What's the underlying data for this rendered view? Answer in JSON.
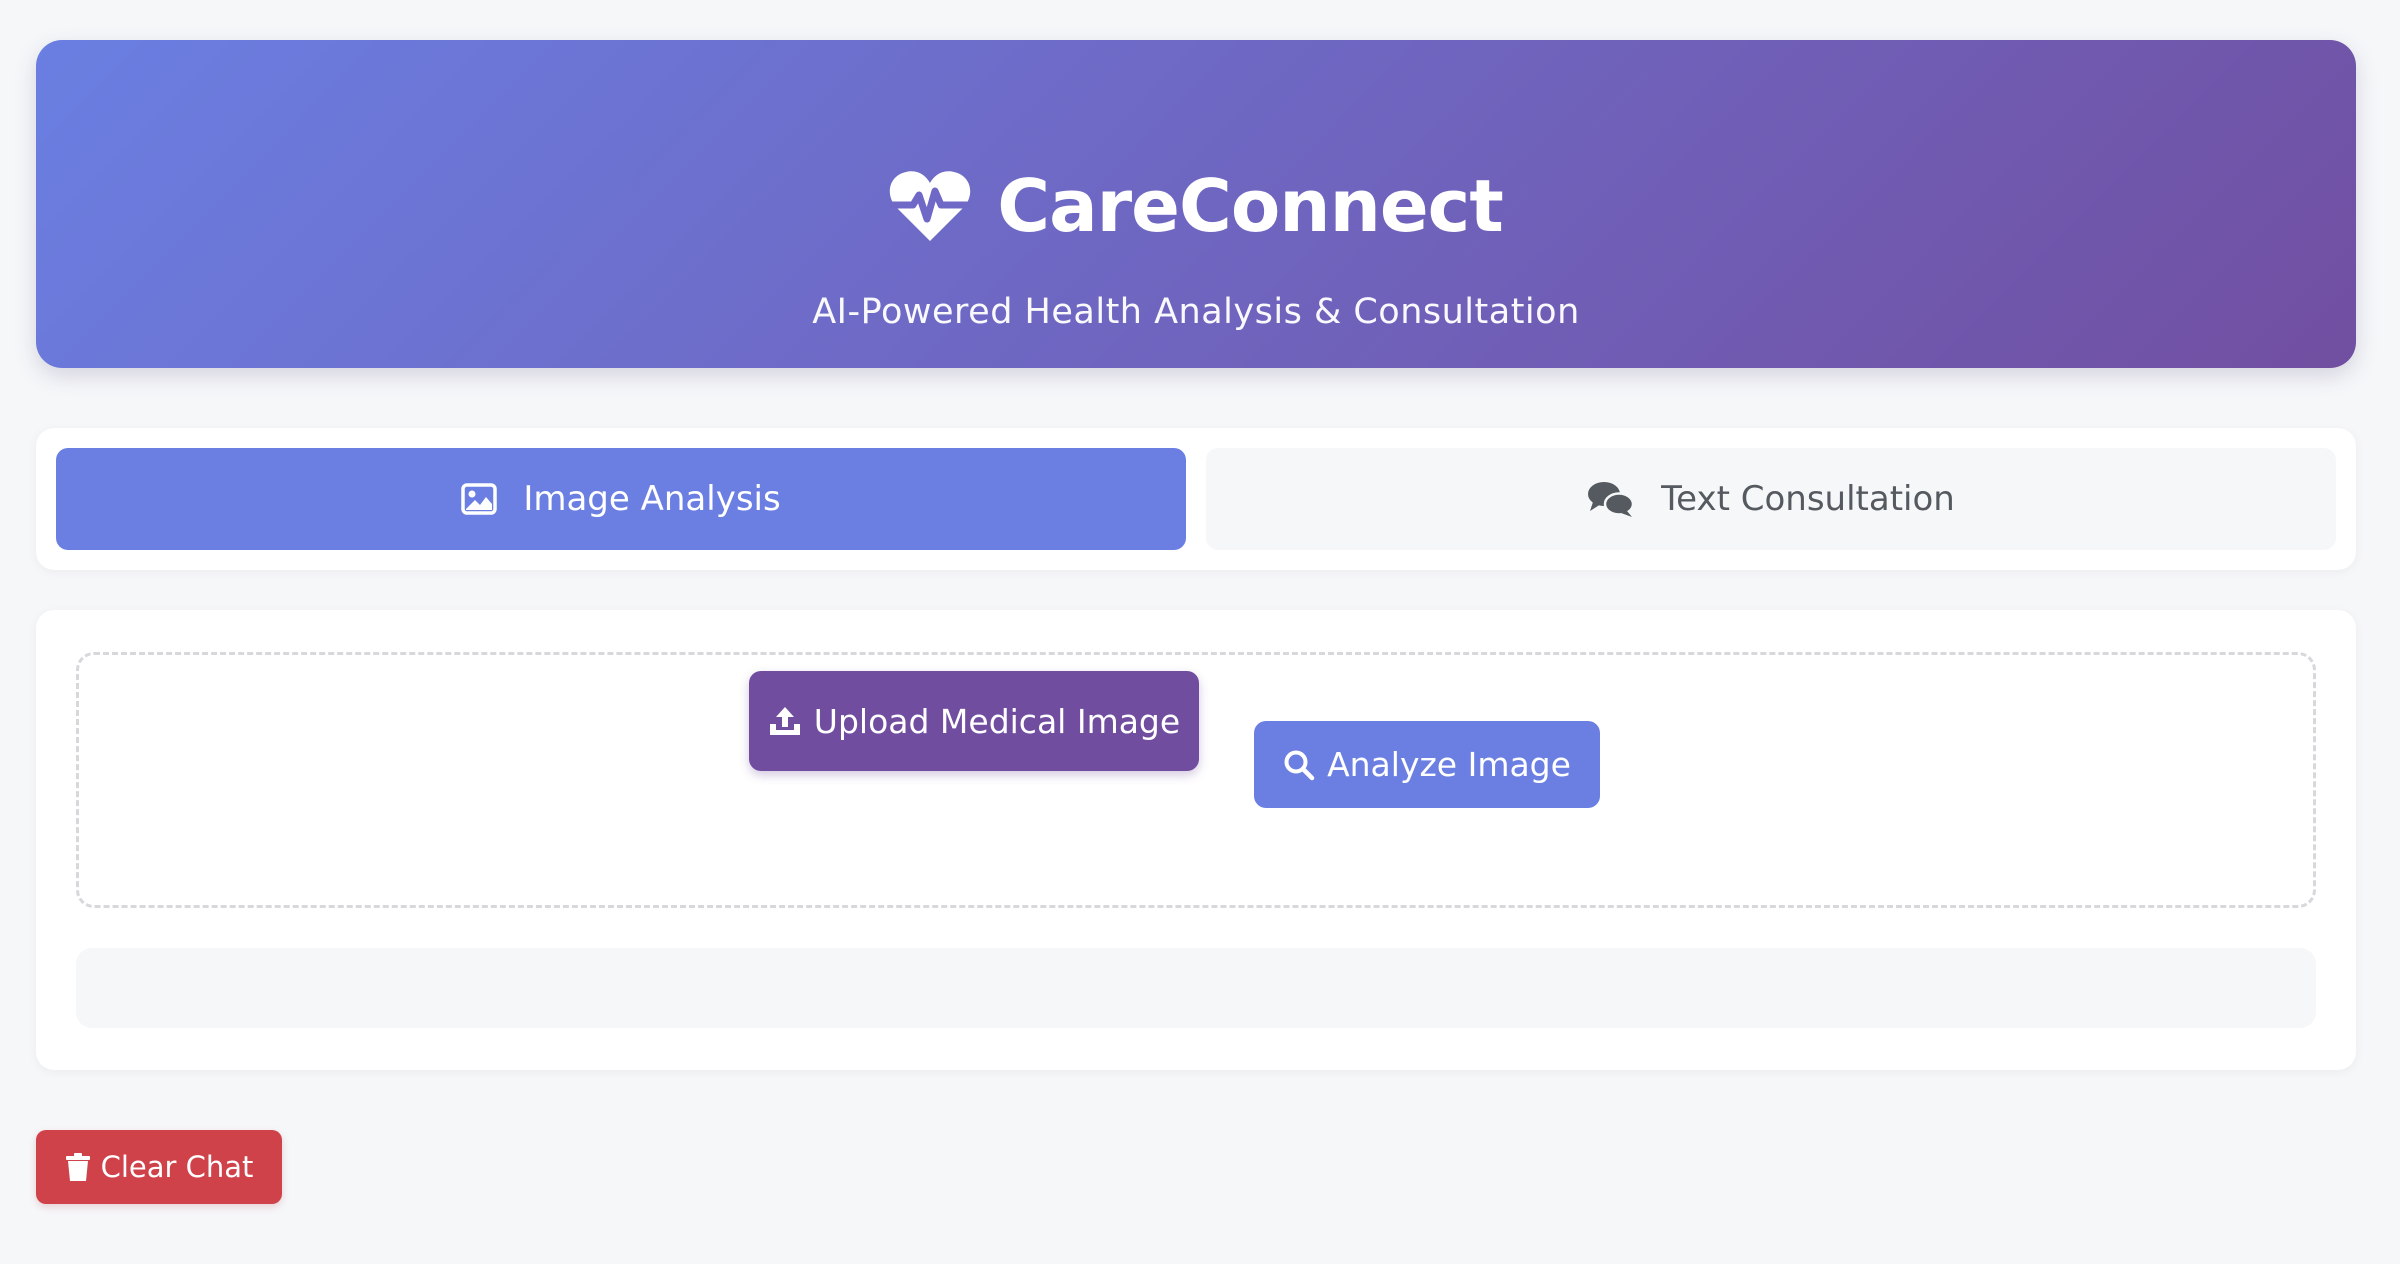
{
  "header": {
    "title": "CareConnect",
    "subtitle": "AI-Powered Health Analysis & Consultation",
    "icon": "heartbeat-icon"
  },
  "tabs": [
    {
      "label": "Image Analysis",
      "icon": "image-icon",
      "active": true
    },
    {
      "label": "Text Consultation",
      "icon": "comments-icon",
      "active": false
    }
  ],
  "image_panel": {
    "upload_label": "Upload Medical Image",
    "upload_icon": "upload-icon",
    "analyze_label": "Analyze Image",
    "analyze_icon": "search-icon"
  },
  "actions": {
    "clear_label": "Clear Chat",
    "clear_icon": "trash-icon"
  },
  "colors": {
    "header_gradient_start": "#6a7fe2",
    "header_gradient_end": "#714fa1",
    "accent": "#6b7fe3",
    "upload_button": "#714da0",
    "danger": "#d0424a",
    "background": "#f6f7f9"
  }
}
